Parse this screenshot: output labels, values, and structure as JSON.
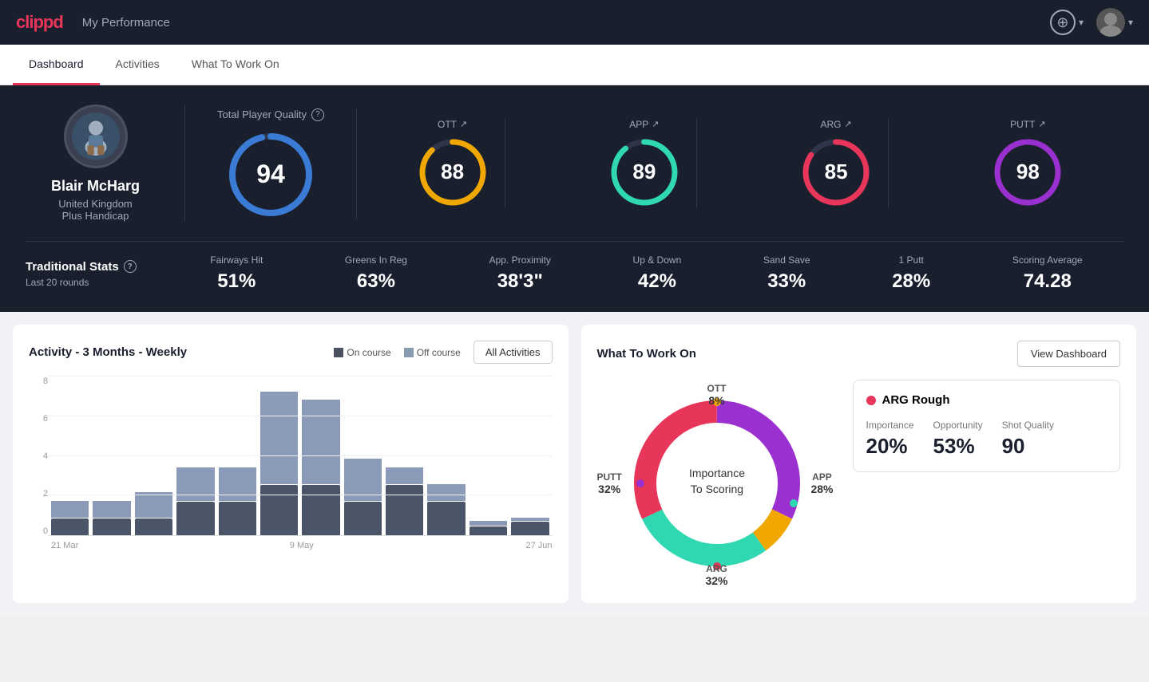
{
  "header": {
    "logo": "clippd",
    "title": "My Performance",
    "add_label": "+",
    "dropdown_label": "▾"
  },
  "tabs": [
    {
      "id": "dashboard",
      "label": "Dashboard",
      "active": true
    },
    {
      "id": "activities",
      "label": "Activities",
      "active": false
    },
    {
      "id": "what-to-work-on",
      "label": "What To Work On",
      "active": false
    }
  ],
  "player": {
    "name": "Blair McHarg",
    "country": "United Kingdom",
    "handicap": "Plus Handicap"
  },
  "total_quality": {
    "label": "Total Player Quality",
    "score": 94
  },
  "sub_scores": [
    {
      "id": "ott",
      "label": "OTT",
      "score": 88,
      "color": "#f0a800",
      "bg": "#2e3548",
      "pct": 88
    },
    {
      "id": "app",
      "label": "APP",
      "score": 89,
      "color": "#2fd8b0",
      "bg": "#2e3548",
      "pct": 89
    },
    {
      "id": "arg",
      "label": "ARG",
      "score": 85,
      "color": "#e8355a",
      "bg": "#2e3548",
      "pct": 85
    },
    {
      "id": "putt",
      "label": "PUTT",
      "score": 98,
      "color": "#9b30d0",
      "bg": "#2e3548",
      "pct": 98
    }
  ],
  "trad_stats": {
    "title": "Traditional Stats",
    "subtitle": "Last 20 rounds",
    "items": [
      {
        "label": "Fairways Hit",
        "value": "51%"
      },
      {
        "label": "Greens In Reg",
        "value": "63%"
      },
      {
        "label": "App. Proximity",
        "value": "38'3\""
      },
      {
        "label": "Up & Down",
        "value": "42%"
      },
      {
        "label": "Sand Save",
        "value": "33%"
      },
      {
        "label": "1 Putt",
        "value": "28%"
      },
      {
        "label": "Scoring Average",
        "value": "74.28"
      }
    ]
  },
  "activity_chart": {
    "title": "Activity - 3 Months - Weekly",
    "legend": {
      "on_course": "On course",
      "off_course": "Off course"
    },
    "all_activities_btn": "All Activities",
    "y_labels": [
      "0",
      "2",
      "4",
      "6",
      "8"
    ],
    "x_labels": [
      "21 Mar",
      "",
      "",
      "",
      "",
      "9 May",
      "",
      "",
      "",
      "",
      "27 Jun"
    ],
    "bars": [
      {
        "on": 1,
        "off": 1
      },
      {
        "on": 1,
        "off": 1
      },
      {
        "on": 1,
        "off": 1.5
      },
      {
        "on": 2,
        "off": 2
      },
      {
        "on": 2,
        "off": 2
      },
      {
        "on": 3,
        "off": 5.5
      },
      {
        "on": 3,
        "off": 5
      },
      {
        "on": 2,
        "off": 2.5
      },
      {
        "on": 3,
        "off": 1
      },
      {
        "on": 2,
        "off": 1
      },
      {
        "on": 0.5,
        "off": 0.3
      },
      {
        "on": 0.8,
        "off": 0.2
      }
    ]
  },
  "wtwo": {
    "title": "What To Work On",
    "view_dashboard_btn": "View Dashboard",
    "donut_segments": [
      {
        "label": "OTT",
        "pct": "8%",
        "color": "#f0a800"
      },
      {
        "label": "APP",
        "pct": "28%",
        "color": "#2fd8b0"
      },
      {
        "label": "ARG",
        "pct": "32%",
        "color": "#e8355a"
      },
      {
        "label": "PUTT",
        "pct": "32%",
        "color": "#9b30d0"
      }
    ],
    "center_text": "Importance\nTo Scoring",
    "card": {
      "dot_color": "#e8355a",
      "title": "ARG Rough",
      "metrics": [
        {
          "label": "Importance",
          "value": "20%"
        },
        {
          "label": "Opportunity",
          "value": "53%"
        },
        {
          "label": "Shot Quality",
          "value": "90"
        }
      ]
    }
  }
}
